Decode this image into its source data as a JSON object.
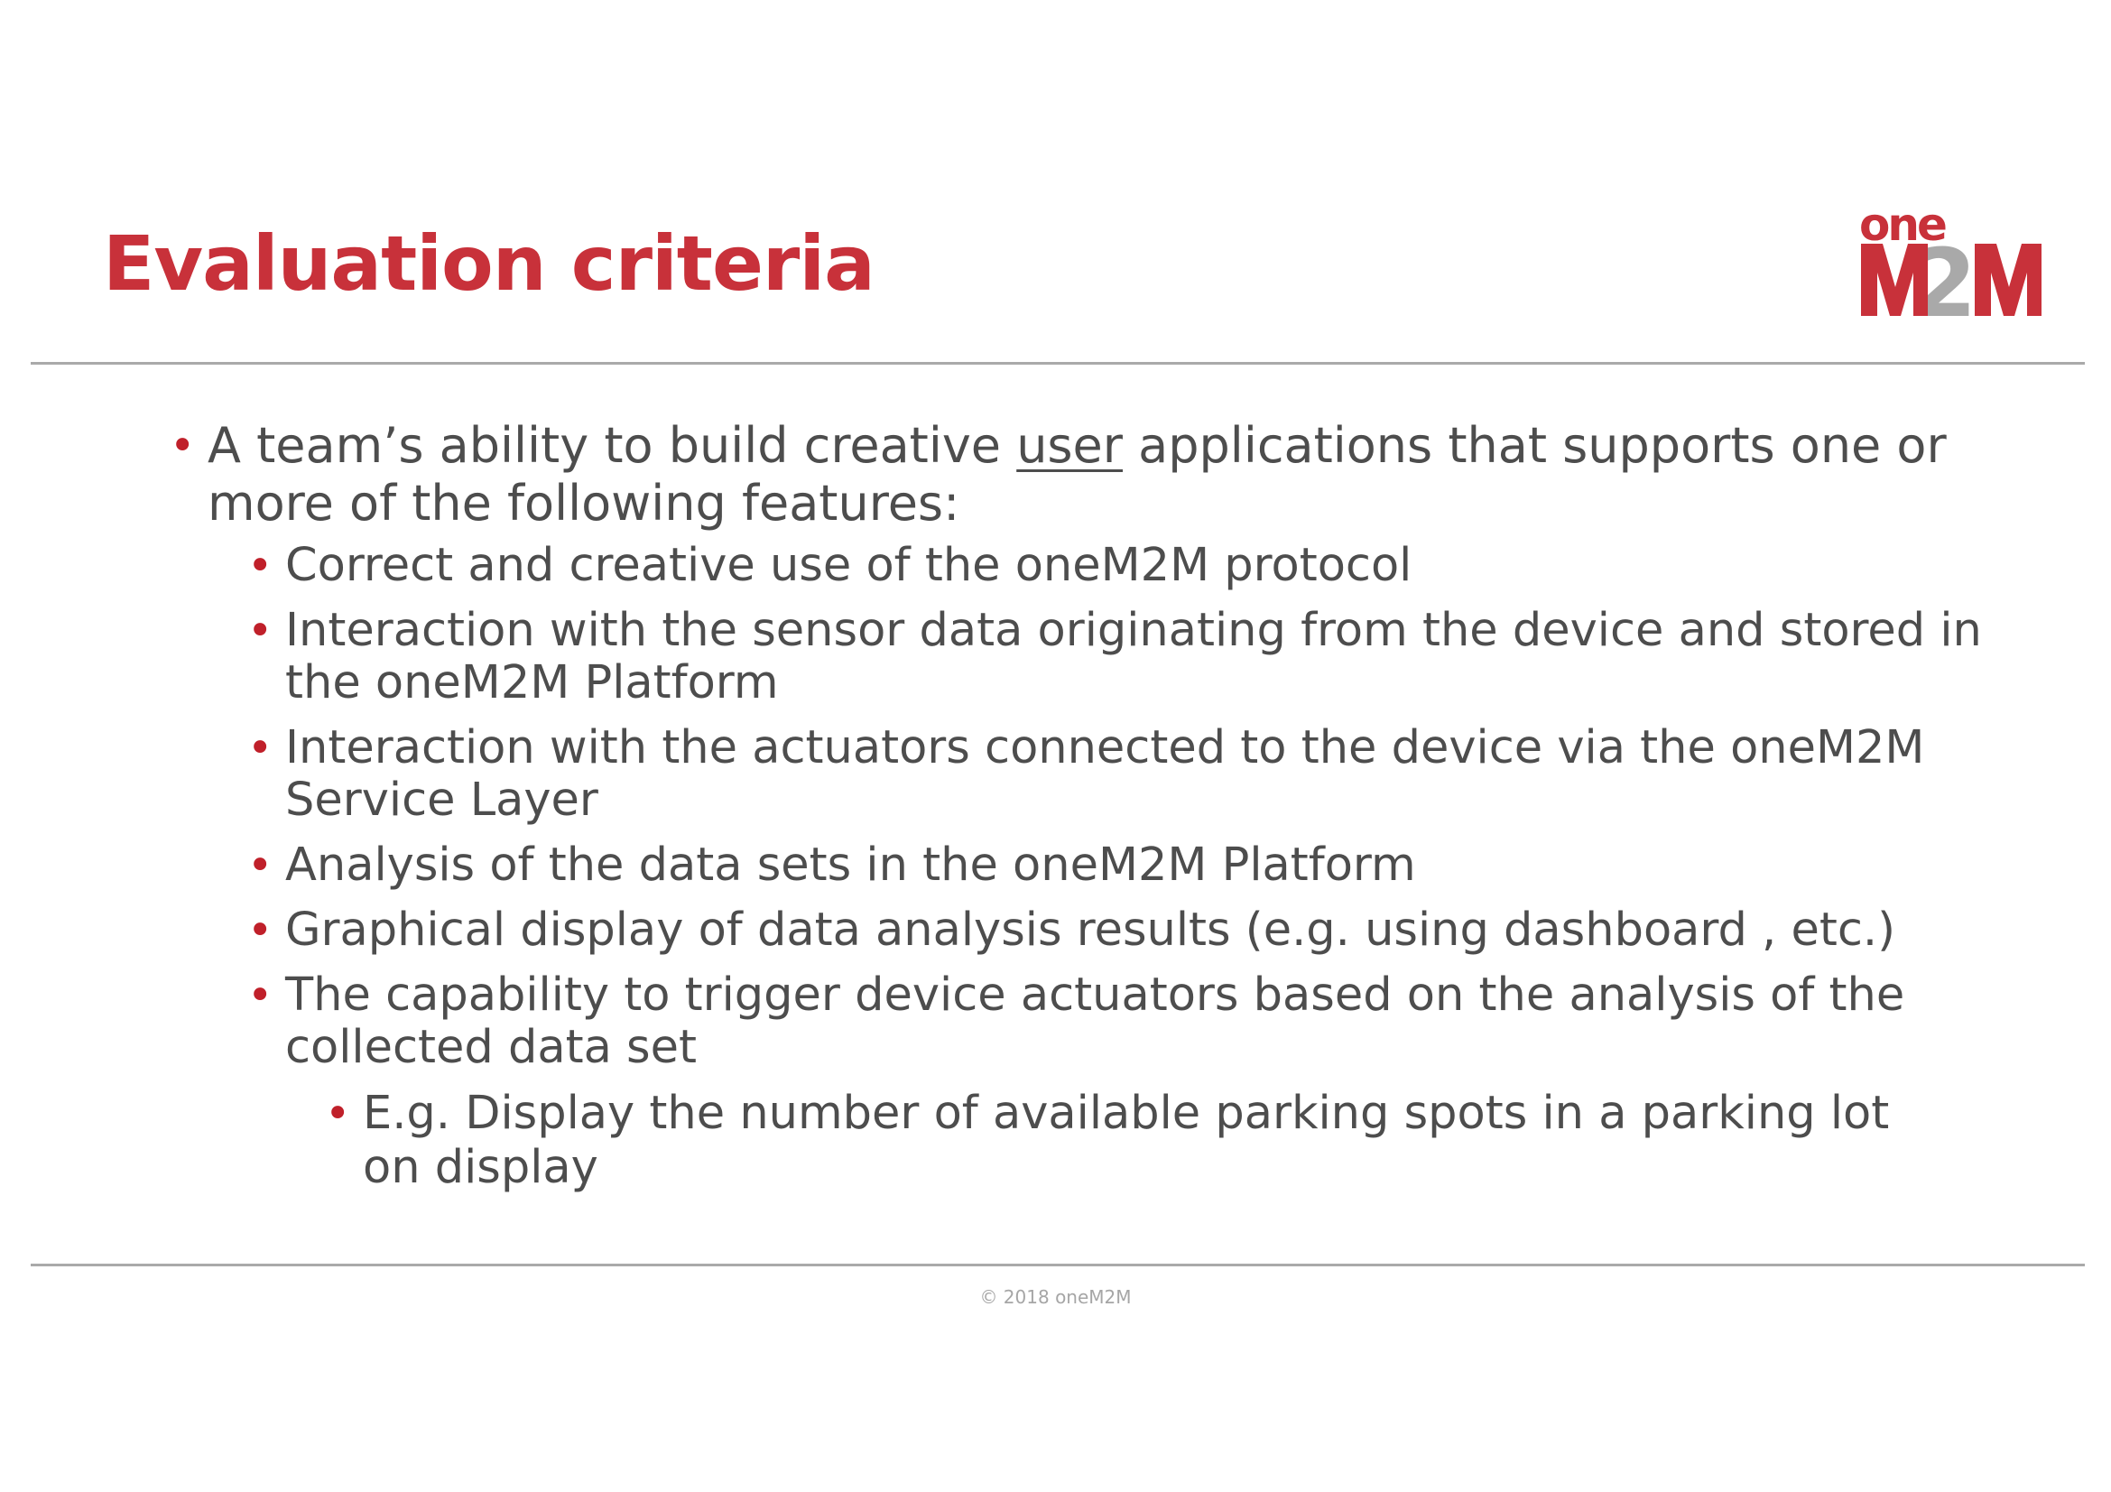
{
  "slide": {
    "title": "Evaluation criteria",
    "colors": {
      "title": "#c8313a",
      "body": "#4d4d4d",
      "bullet": "#c0202a",
      "rule": "#aaaaaa",
      "footer": "#a6a6a6",
      "logo_red": "#c8313a",
      "logo_gray": "#a9a9a9"
    },
    "logo": {
      "icon": "onem2m-logo",
      "top_text": "one",
      "bottom_text": "M2M"
    },
    "bullet_glyph": "•",
    "main_point": {
      "before": "A team’s ability to build creative ",
      "underlined": "user",
      "after": " applications that supports one or more of the following features:"
    },
    "features": [
      "Correct and creative use of the oneM2M protocol",
      "Interaction with the sensor data originating from the device and stored in the oneM2M Platform",
      "Interaction with the actuators connected to the device via the oneM2M Service Layer",
      "Analysis of the data sets in the oneM2M Platform",
      "Graphical display of data analysis results (e.g. using dashboard , etc.)",
      "The capability to trigger device actuators based on the analysis of the collected data set"
    ],
    "example": "E.g. Display the number of available parking spots in a parking lot on display",
    "footer": "© 2018 oneM2M"
  }
}
